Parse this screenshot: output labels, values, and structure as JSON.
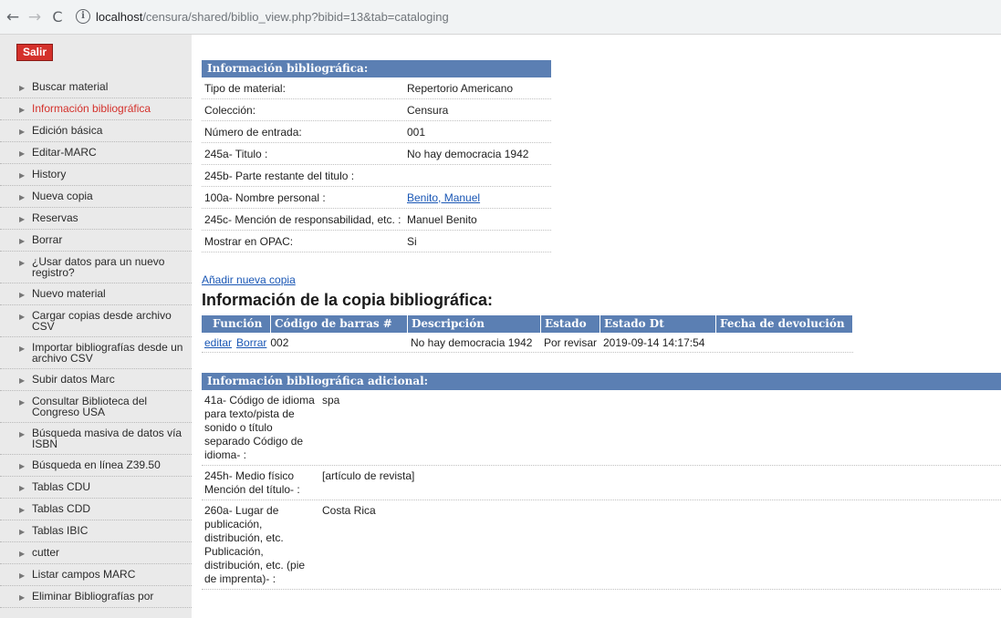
{
  "browser": {
    "url_host": "localhost",
    "url_path": "/censura/shared/biblio_view.php?bibid=13&tab=cataloging"
  },
  "sidebar": {
    "exit_label": "Salir",
    "items": [
      {
        "label": "Buscar material",
        "active": false
      },
      {
        "label": "Información bibliográfica",
        "active": true
      },
      {
        "label": "Edición básica",
        "active": false
      },
      {
        "label": "Editar-MARC",
        "active": false
      },
      {
        "label": "History",
        "active": false
      },
      {
        "label": "Nueva copia",
        "active": false
      },
      {
        "label": "Reservas",
        "active": false
      },
      {
        "label": "Borrar",
        "active": false
      },
      {
        "label": "¿Usar datos para un nuevo registro?",
        "active": false
      },
      {
        "label": "Nuevo material",
        "active": false
      },
      {
        "label": "Cargar copias desde archivo CSV",
        "active": false
      },
      {
        "label": "Importar bibliografías desde un archivo CSV",
        "active": false
      },
      {
        "label": "Subir datos Marc",
        "active": false
      },
      {
        "label": "Consultar Biblioteca del Congreso USA",
        "active": false
      },
      {
        "label": "Búsqueda masiva de datos vía ISBN",
        "active": false
      },
      {
        "label": "Búsqueda en línea Z39.50",
        "active": false
      },
      {
        "label": "Tablas CDU",
        "active": false
      },
      {
        "label": "Tablas CDD",
        "active": false
      },
      {
        "label": "Tablas IBIC",
        "active": false
      },
      {
        "label": "cutter",
        "active": false
      },
      {
        "label": "Listar campos MARC",
        "active": false
      },
      {
        "label": "Eliminar Bibliografías por",
        "active": false
      }
    ]
  },
  "biblio_info": {
    "header": "Información bibliográfica:",
    "rows": [
      {
        "label": "Tipo de material:",
        "value": "Repertorio Americano"
      },
      {
        "label": "Colección:",
        "value": "Censura"
      },
      {
        "label": "Número de entrada:",
        "value": "001"
      },
      {
        "label": "245a- Titulo :",
        "value": "No hay democracia 1942"
      },
      {
        "label": "245b- Parte restante del titulo :",
        "value": ""
      },
      {
        "label": "100a- Nombre personal :",
        "value": "Benito, Manuel"
      },
      {
        "label": "245c- Mención de responsabilidad, etc. :",
        "value": "Manuel Benito"
      },
      {
        "label": "Mostrar en OPAC:",
        "value": "Si"
      }
    ]
  },
  "copies": {
    "add_link": "Añadir nueva copia",
    "title": "Información de la copia bibliográfica:",
    "columns": [
      "Función",
      "Código de barras #",
      "Descripción",
      "Estado",
      "Estado Dt",
      "Fecha de devolución"
    ],
    "rows": [
      {
        "edit": "editar",
        "delete": "Borrar",
        "barcode": "002",
        "description": "No hay democracia 1942",
        "status": "Por revisar",
        "status_dt": "2019-09-14 14:17:54",
        "due": ""
      }
    ]
  },
  "extra_info": {
    "header": "Información bibliográfica adicional:",
    "rows": [
      {
        "label": "41a- Código de idioma para texto/pista de sonido o título separado Código de idioma- :",
        "value": "spa"
      },
      {
        "label": "245h- Medio físico Mención del título- :",
        "value": "[artículo de revista]"
      },
      {
        "label": "260a- Lugar de publicación, distribución, etc. Publicación, distribución, etc. (pie de imprenta)- :",
        "value": "Costa Rica"
      }
    ]
  }
}
